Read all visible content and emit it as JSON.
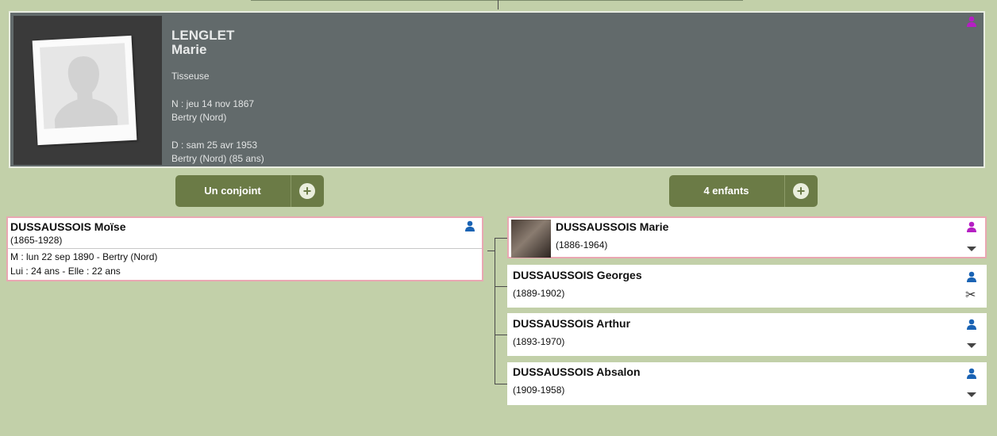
{
  "main_person": {
    "surname": "LENGLET",
    "firstname": "Marie",
    "occupation": "Tisseuse",
    "birth_date": "N : jeu 14 nov 1867",
    "birth_place": "Bertry (Nord)",
    "death_date": "D : sam 25 avr 1953",
    "death_place": "Bertry (Nord) (85 ans)"
  },
  "actions": {
    "spouse_button_label": "Un conjoint",
    "children_button_label": "4 enfants"
  },
  "spouse": {
    "name": "DUSSAUSSOIS Moïse",
    "dates": "(1865-1928)",
    "marriage": "M : lun 22 sep 1890 - Bertry (Nord)",
    "ages": "Lui : 24 ans - Elle : 22 ans"
  },
  "children": [
    {
      "name": "DUSSAUSSOIS Marie",
      "dates": "(1886-1964)"
    },
    {
      "name": "DUSSAUSSOIS Georges",
      "dates": "(1889-1902)"
    },
    {
      "name": "DUSSAUSSOIS Arthur",
      "dates": "(1893-1970)"
    },
    {
      "name": "DUSSAUSSOIS Absalon",
      "dates": "(1909-1958)"
    }
  ],
  "icons": {
    "female_person": "person-icon",
    "male_person": "person-icon",
    "expand": "chevron-down-icon",
    "scissors": "scissors-icon",
    "add": "plus-icon"
  },
  "colors": {
    "background": "#c2d0a9",
    "card_dark": "#626a6b",
    "button_olive": "#6b7b46",
    "highlight_border": "#e9a7b2",
    "female_icon": "#b51fc3",
    "male_icon": "#1a63b4"
  }
}
